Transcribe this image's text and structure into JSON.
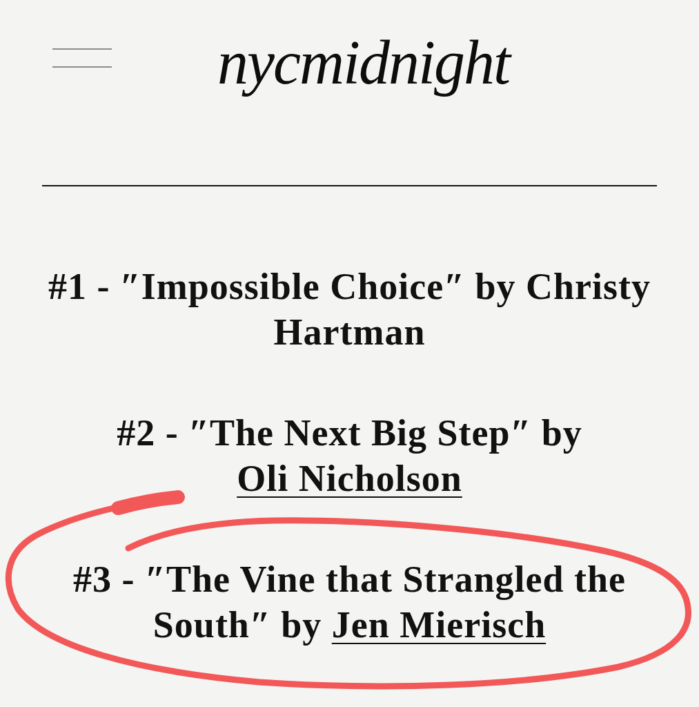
{
  "header": {
    "logo": "nycmidnight"
  },
  "entries": [
    {
      "text": "#1 - ″Impossible Choice″ by ",
      "author": "Christy Hartman",
      "author_link": false,
      "circled": false
    },
    {
      "text": "#2 - ″The Next Big Step″ by ",
      "author": "Oli Nicholson",
      "author_link": true,
      "circled": false
    },
    {
      "text": "#3 - ″The Vine that Strangled the South″ by ",
      "author": "Jen Mierisch",
      "author_link": true,
      "circled": true
    }
  ]
}
